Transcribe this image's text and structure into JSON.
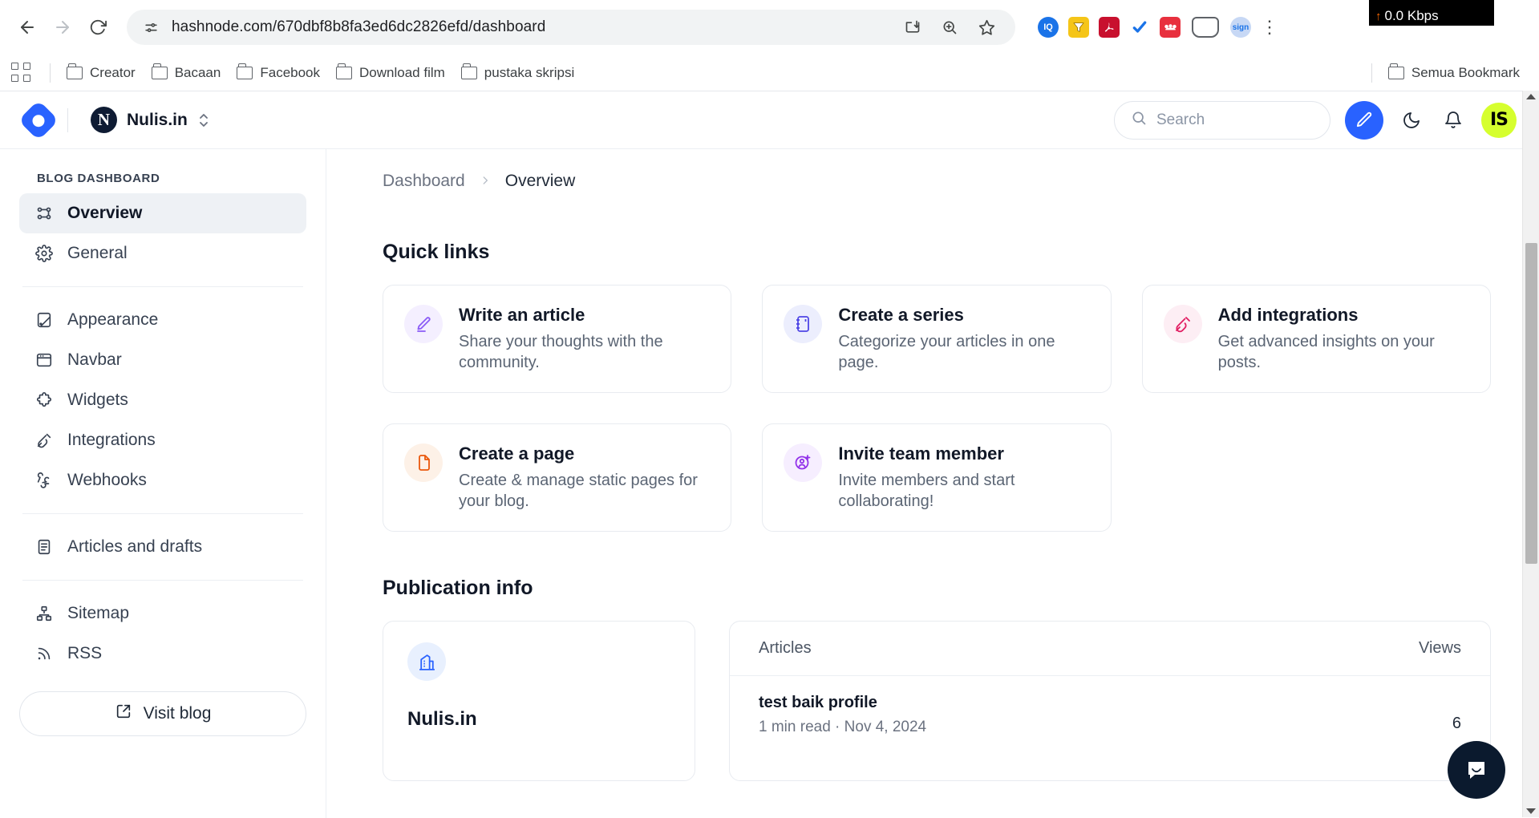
{
  "browser": {
    "url": "hashnode.com/670dbf8b8fa3ed6dc2826efd/dashboard",
    "back_label": "Back",
    "forward_label": "Forward",
    "reload_label": "Reload",
    "site_info_label": "View site information",
    "install_label": "Install",
    "zoom_label": "Zoom",
    "bookmark_label": "Bookmark this tab",
    "menu_label": "Customize and control Chrome",
    "extensions": [
      {
        "name": "iq-extension-icon",
        "label": "IQ",
        "color": "#1a73e8"
      },
      {
        "name": "funnel-extension-icon",
        "label": "",
        "color": "#f5c518"
      },
      {
        "name": "adobe-acrobat-extension-icon",
        "label": "A",
        "color": "#c8102e"
      },
      {
        "name": "checkmark-extension-icon",
        "label": "✔",
        "color": "#1a73e8"
      },
      {
        "name": "mendeley-extension-icon",
        "label": "M",
        "color": "#e8303e"
      }
    ],
    "bookmarks": [
      {
        "label": "Creator"
      },
      {
        "label": "Bacaan"
      },
      {
        "label": "Facebook"
      },
      {
        "label": "Download film"
      },
      {
        "label": "pustaka skripsi"
      }
    ],
    "bookmarks_right": "Semua Bookmark",
    "network_tooltip": {
      "value": "0.0 Kbps",
      "arrow": "↑"
    }
  },
  "app_header": {
    "logo_name": "hashnode-logo",
    "publication": "Nulis.in",
    "publication_initial": "N",
    "switch_label": "Switch publication",
    "search": {
      "placeholder": "Search",
      "value": "Search"
    },
    "write_label": "Write",
    "theme_label": "Toggle dark mode",
    "notifications_label": "Notifications",
    "avatar_initials": "IS"
  },
  "sidebar": {
    "title": "BLOG DASHBOARD",
    "group1": [
      {
        "label": "Overview",
        "icon": "overview-icon",
        "active": true
      },
      {
        "label": "General",
        "icon": "gear-icon",
        "active": false
      }
    ],
    "group2": [
      {
        "label": "Appearance",
        "icon": "appearance-icon"
      },
      {
        "label": "Navbar",
        "icon": "navbar-icon"
      },
      {
        "label": "Widgets",
        "icon": "puzzle-icon"
      },
      {
        "label": "Integrations",
        "icon": "plug-icon"
      },
      {
        "label": "Webhooks",
        "icon": "webhook-icon"
      }
    ],
    "group3": [
      {
        "label": "Articles and drafts",
        "icon": "document-icon"
      }
    ],
    "group4": [
      {
        "label": "Sitemap",
        "icon": "sitemap-icon"
      },
      {
        "label": "RSS",
        "icon": "rss-icon"
      }
    ],
    "visit_blog": "Visit blog"
  },
  "breadcrumb": {
    "parent": "Dashboard",
    "separator": "›",
    "current": "Overview"
  },
  "quick_links": {
    "heading": "Quick links",
    "cards": [
      {
        "title": "Write an article",
        "desc": "Share your thoughts with the community.",
        "icon": "pencil-icon",
        "icon_color": "#8b5cf6",
        "icon_bg": "#f4efff"
      },
      {
        "title": "Create a series",
        "desc": "Categorize your articles in one page.",
        "icon": "notebook-icon",
        "icon_color": "#4f46e5",
        "icon_bg": "#eceefd"
      },
      {
        "title": "Add integrations",
        "desc": "Get advanced insights on your posts.",
        "icon": "plug-icon",
        "icon_color": "#e11d62",
        "icon_bg": "#fdeef4"
      },
      {
        "title": "Create a page",
        "desc": "Create & manage static pages for your blog.",
        "icon": "file-icon",
        "icon_color": "#ea580c",
        "icon_bg": "#fdf1e7"
      },
      {
        "title": "Invite team member",
        "desc": "Invite members and start collaborating!",
        "icon": "user-plus-icon",
        "icon_color": "#9333ea",
        "icon_bg": "#f6eeff"
      }
    ]
  },
  "publication_info": {
    "heading": "Publication info",
    "card": {
      "icon": "building-icon",
      "name": "Nulis.in"
    },
    "articles_table": {
      "col_articles": "Articles",
      "col_views": "Views",
      "rows": [
        {
          "title": "test baik profile",
          "meta": "1 min read · Nov 4, 2024",
          "views": "6"
        }
      ]
    }
  },
  "chat_widget": {
    "label": "Open Intercom messenger",
    "icon": "chat-bubble-icon"
  }
}
